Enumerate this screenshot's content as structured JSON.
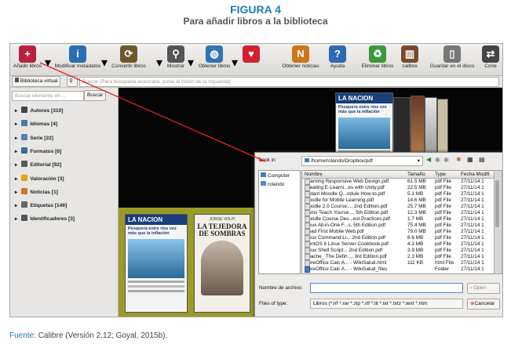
{
  "figure": {
    "title": "FIGURA 4",
    "subtitle": "Para añadir libros a la biblioteca",
    "source_label": "Fuente",
    "source_text": ": Calibre (Versión 2.12; Goyal, 2015b)."
  },
  "toolbar": {
    "items": [
      {
        "label": "Añadir libros",
        "icon": "add-book-icon",
        "color": "#b8213d"
      },
      {
        "label": "Modificar metadatos",
        "icon": "info-icon",
        "color": "#2a6db3"
      },
      {
        "label": "Convertir libros",
        "icon": "convert-book-icon",
        "color": "#6b5a2a"
      },
      {
        "label": "Mostrar",
        "icon": "magnifier-icon",
        "color": "#555555"
      },
      {
        "label": "Obtener libros",
        "icon": "globe-icon",
        "color": "#2f74b9"
      },
      {
        "label": "",
        "icon": "heart-icon",
        "color": "#d1202f"
      },
      {
        "label": "Obtener noticias",
        "icon": "news-icon",
        "color": "#d0741b"
      },
      {
        "label": "Ayuda",
        "icon": "help-icon",
        "color": "#2d69b4"
      },
      {
        "label": "Eliminar libros",
        "icon": "recycle-icon",
        "color": "#3a9a3a"
      },
      {
        "label": "calibre",
        "icon": "library-icon",
        "color": "#7a4a2a"
      },
      {
        "label": "Guardar en el disco",
        "icon": "device-icon",
        "color": "#777777"
      },
      {
        "label": "Cone",
        "icon": "connect-icon",
        "color": "#444444"
      }
    ]
  },
  "searchbar": {
    "virtual_library_label": "Biblioteca virtual",
    "search_placeholder": "Buscar (Para búsqueda avanzada, pulse el botón de la izquierda)"
  },
  "sidebar": {
    "find_placeholder": "Buscar elemento en ...",
    "find_button": "Buscar",
    "categories": [
      {
        "label": "Autores [310]",
        "icon": "author-icon",
        "color": "#444444"
      },
      {
        "label": "Idiomas [4]",
        "icon": "language-icon",
        "color": "#4a7aa8"
      },
      {
        "label": "Serie [22]",
        "icon": "series-icon",
        "color": "#5a7fb0"
      },
      {
        "label": "Formatos [6]",
        "icon": "format-icon",
        "color": "#3a6a9a"
      },
      {
        "label": "Editorial [92]",
        "icon": "publisher-icon",
        "color": "#5a5a5a"
      },
      {
        "label": "Valoración [3]",
        "icon": "rating-icon",
        "color": "#e0a800"
      },
      {
        "label": "Noticias [1]",
        "icon": "news-tag-icon",
        "color": "#d0741b"
      },
      {
        "label": "Etiquetas [146]",
        "icon": "tag-icon",
        "color": "#666666"
      },
      {
        "label": "Identificadores [3]",
        "icon": "identifier-icon",
        "color": "#555555"
      }
    ]
  },
  "covers": {
    "newspaper_name": "LA NACION",
    "newspaper_headline": "Pesquera entre ríos vez más que la inflación",
    "novel_author": "JORGE VOLPI",
    "novel_title": "LA TEJEDORA DE SOMBRAS"
  },
  "dialog": {
    "look_in_label": "Look in:",
    "path": "/home/rolando/Dropbox/pdf",
    "places": [
      "Computer",
      "rolando"
    ],
    "columns": [
      "Nombre",
      "Tamaño",
      "Type",
      "Fecha Modifi"
    ],
    "files": [
      {
        "name": "Learning Responsive Web Design.pdf",
        "size": "61.5 MB",
        "type": "pdf File",
        "date": "27/11/14 1"
      },
      {
        "name": "Creating E-Learni...es with Unity.pdf",
        "size": "22.5 MB",
        "type": "pdf File",
        "date": "27/11/14 1"
      },
      {
        "name": "Instant Moodle Q...odule How-to.pdf",
        "size": "5.1 MB",
        "type": "pdf File",
        "date": "27/11/14 1"
      },
      {
        "name": "Moodle for Mobile Learning.pdf",
        "size": "14.6 MB",
        "type": "pdf File",
        "date": "27/11/14 1"
      },
      {
        "name": "Moodle 2.0 Course..., 2nd Edition.pdf",
        "size": "25.7 MB",
        "type": "pdf File",
        "date": "27/11/14 1"
      },
      {
        "name": "Sams Teach Yourse..., 5th Edition.pdf",
        "size": "12.3 MB",
        "type": "pdf File",
        "date": "27/11/14 1"
      },
      {
        "name": "Moodle Course Des...est Practices.pdf",
        "size": "1.7 MB",
        "type": "pdf File",
        "date": "27/11/14 1"
      },
      {
        "name": "Linux All-in-One F...s, 5th Edition.pdf",
        "size": "75.4 MB",
        "type": "pdf File",
        "date": "27/11/14 1"
      },
      {
        "name": "Head First Mobile Web.pdf",
        "size": "79.0 MB",
        "type": "pdf File",
        "date": "27/11/14 1"
      },
      {
        "name": "Linux Command Li... 2nd Edition.pdf",
        "size": "8.6 MB",
        "type": "pdf File",
        "date": "27/11/14 1"
      },
      {
        "name": "CentOS 6 Linux Server Cookbook.pdf",
        "size": "4.3 MB",
        "type": "pdf File",
        "date": "27/11/14 1"
      },
      {
        "name": "Linux Shell Script... 2nd Edition.pdf",
        "size": "3.9 MB",
        "type": "pdf File",
        "date": "27/11/14 1"
      },
      {
        "name": "Apache_ The Defin..., 3rd Edition.pdf",
        "size": "2.3 MB",
        "type": "pdf File",
        "date": "27/11/14 1"
      },
      {
        "name": "LibreOffice Calc A... - WikiSalud.html",
        "size": "111 KB",
        "type": "html File",
        "date": "27/11/14 1"
      },
      {
        "name": "LibreOffice Calc A... - WikiSalud_files",
        "size": "",
        "type": "Folder",
        "date": "27/11/14 1"
      }
    ],
    "filename_label": "Nombre de archivo:",
    "filename_value": "",
    "filetype_label": "Files of type:",
    "filetype_value": "Libros (*.lrf *.rar *.zip *.rtf *.lit *.txt *.txtz *.text *.htm",
    "open_button": "Open",
    "cancel_button": "Cancelar"
  }
}
